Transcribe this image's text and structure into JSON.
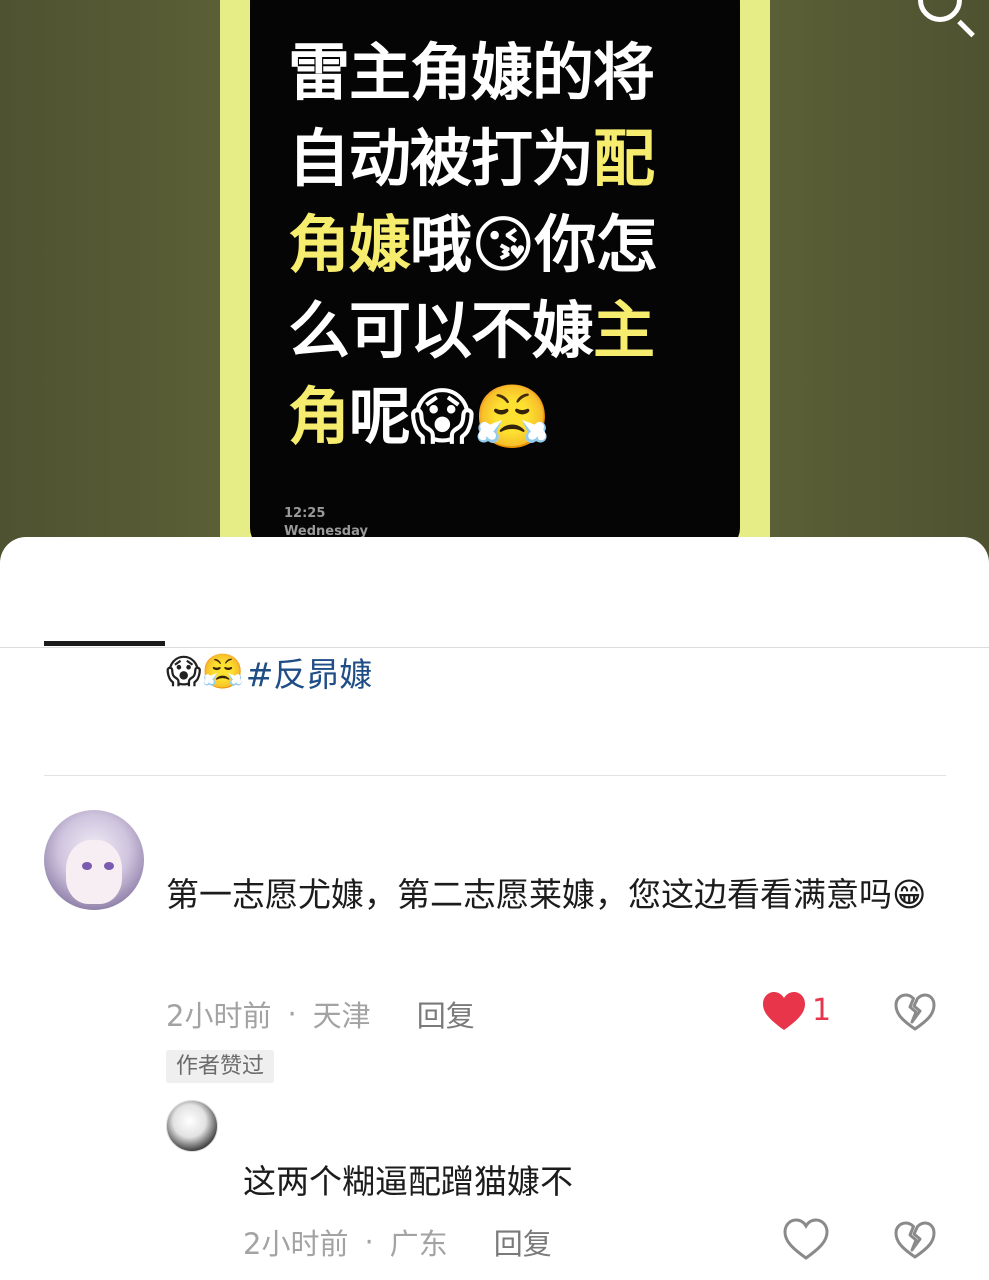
{
  "video": {
    "poster_lines": [
      [
        {
          "t": "雷主角嫝的将",
          "hl": false
        }
      ],
      [
        {
          "t": "自动被打为",
          "hl": false
        },
        {
          "t": "配",
          "hl": true
        }
      ],
      [
        {
          "t": "角嫝",
          "hl": true
        },
        {
          "t": "哦😘你怎",
          "hl": false
        }
      ],
      [
        {
          "t": "么可以不嫝",
          "hl": false
        },
        {
          "t": "主",
          "hl": true
        }
      ],
      [
        {
          "t": "角",
          "hl": true
        },
        {
          "t": "呢😱😤",
          "hl": false
        }
      ]
    ],
    "screen_time": "12:25",
    "screen_day": "Wednesday"
  },
  "post": {
    "emojis": "😱😤",
    "hashtag": "#反昴嫝"
  },
  "comment": {
    "text": "第一志愿尤嫝，第二志愿莱嫝，您这边看看满意吗😁",
    "time": "2小时前",
    "location": "天津",
    "reply_label": "回复",
    "likes": "1",
    "badge": "作者赞过"
  },
  "reply": {
    "text": "这两个糊逼配蹭猫嫝不",
    "time": "2小时前",
    "location": "广东",
    "reply_label": "回复"
  },
  "colors": {
    "accent_like": "#e8354a",
    "hashtag": "#1f4d86",
    "poster_highlight": "#f6ec6e"
  }
}
